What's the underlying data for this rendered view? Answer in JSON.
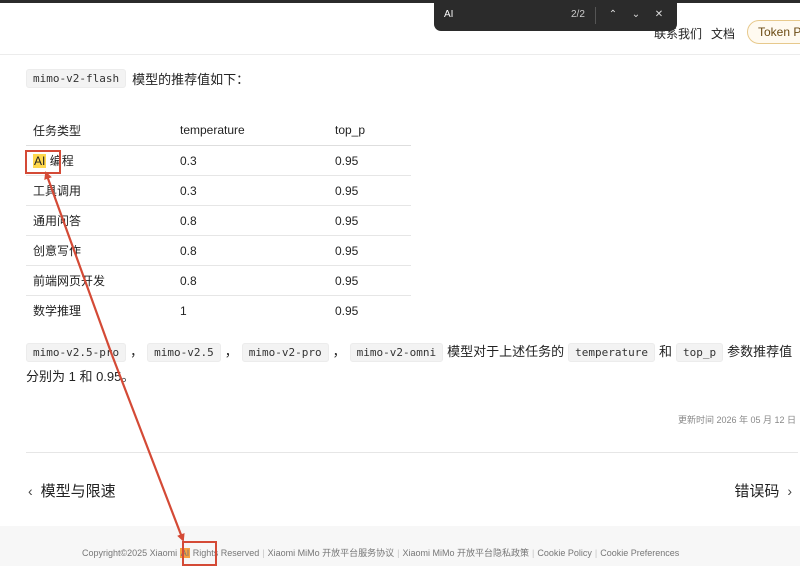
{
  "find_bar": {
    "query": "AI",
    "count": "2/2"
  },
  "header": {
    "nav": [
      "联系我们",
      "文档"
    ],
    "token_button": "Token P"
  },
  "intro": {
    "code": "mimo-v2-flash",
    "text": "模型的推荐值如下："
  },
  "table": {
    "headers": [
      "任务类型",
      "temperature",
      "top_p"
    ],
    "rows": [
      {
        "task_hl": "AI",
        "task": "编程",
        "temperature": "0.3",
        "top_p": "0.95"
      },
      {
        "task": "工具调用",
        "temperature": "0.3",
        "top_p": "0.95"
      },
      {
        "task": "通用问答",
        "temperature": "0.8",
        "top_p": "0.95"
      },
      {
        "task": "创意写作",
        "temperature": "0.8",
        "top_p": "0.95"
      },
      {
        "task": "前端网页开发",
        "temperature": "0.8",
        "top_p": "0.95"
      },
      {
        "task": "数学推理",
        "temperature": "1",
        "top_p": "0.95"
      }
    ]
  },
  "paragraph": {
    "codes": [
      "mimo-v2.5-pro",
      "mimo-v2.5",
      "mimo-v2-pro",
      "mimo-v2-omni",
      "temperature",
      "top_p"
    ],
    "sep": "，",
    "t1": "模型对于上述任务的",
    "t2": "和",
    "t3": "参数推荐值分别为 1 和 0.95。"
  },
  "updated": "更新时间 2026 年 05 月 12 日",
  "pager": {
    "prev": "模型与限速",
    "next": "错误码"
  },
  "footer": {
    "copyright_pre": "Copyright©2025 Xiaomi",
    "copyright_hl": "AI",
    "copyright_post": "Rights Reserved",
    "links": [
      "Xiaomi MiMo 开放平台服务协议",
      "Xiaomi MiMo 开放平台隐私政策",
      "Cookie Policy",
      "Cookie Preferences"
    ]
  },
  "colors": {
    "annotation": "#d44a36",
    "highlight": "#ffd84d",
    "findbar": "#2b2b2b"
  }
}
